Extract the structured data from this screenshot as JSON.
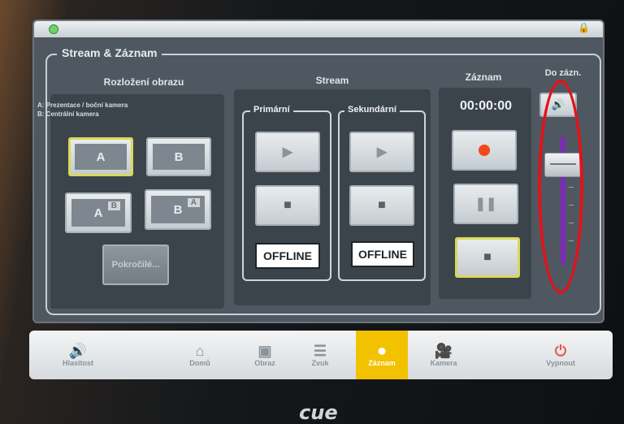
{
  "group": {
    "title": "Stream & Záznam"
  },
  "layout": {
    "title": "Rozložení obrazu",
    "legend_a": "A: Prezentace / boční kamera",
    "legend_b": "B: Centrální kamera",
    "btn_a": "A",
    "btn_b": "B",
    "btn_ab_main": "A",
    "btn_ab_inset": "B",
    "btn_ba_main": "B",
    "btn_ba_inset": "A",
    "advanced": "Pokročilé..."
  },
  "stream": {
    "title": "Stream",
    "primary_label": "Primární",
    "secondary_label": "Sekundární",
    "primary_status": "OFFLINE",
    "secondary_status": "OFFLINE"
  },
  "record": {
    "title": "Záznam",
    "timer": "00:00:00"
  },
  "volume": {
    "title": "Do zázn.",
    "level": 0.85
  },
  "tabs": [
    {
      "label": "Hlasitost",
      "icon": "speaker-icon"
    },
    {
      "label": "Domů",
      "icon": "home-icon"
    },
    {
      "label": "Obraz",
      "icon": "monitor-icon"
    },
    {
      "label": "Zvuk",
      "icon": "mixer-icon"
    },
    {
      "label": "Záznam",
      "icon": "tape-icon",
      "active": true
    },
    {
      "label": "Kamera",
      "icon": "camera-icon"
    },
    {
      "label": "Vypnout",
      "icon": "power-icon"
    }
  ],
  "brand": {
    "logo": "cue"
  },
  "colors": {
    "accent": "#f2c200",
    "record": "#f04a1a",
    "slider": "#7d2ab8",
    "annotation": "#e1121b"
  }
}
